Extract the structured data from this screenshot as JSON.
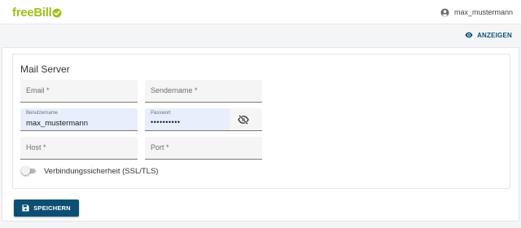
{
  "header": {
    "logo_part1": "free",
    "logo_part2": "Bill",
    "username": "max_mustermann",
    "brand_color": "#9cc11b"
  },
  "actions": {
    "show_label": "ANZEIGEN"
  },
  "form": {
    "title": "Mail Server",
    "email": {
      "placeholder": "Email *",
      "value": ""
    },
    "sender_name": {
      "placeholder": "Sendername *",
      "value": ""
    },
    "username": {
      "label": "Benutzername",
      "value": "max_mustermann"
    },
    "password": {
      "label": "Passwort",
      "value": "••••••••••"
    },
    "host": {
      "placeholder": "Host *",
      "value": ""
    },
    "port": {
      "placeholder": "Port *",
      "value": ""
    },
    "ssl_toggle": {
      "label": "Verbindungssicherheit (SSL/TLS)",
      "checked": false
    }
  },
  "footer": {
    "save_label": "SPEICHERN",
    "accent_color": "#0d4f74"
  }
}
